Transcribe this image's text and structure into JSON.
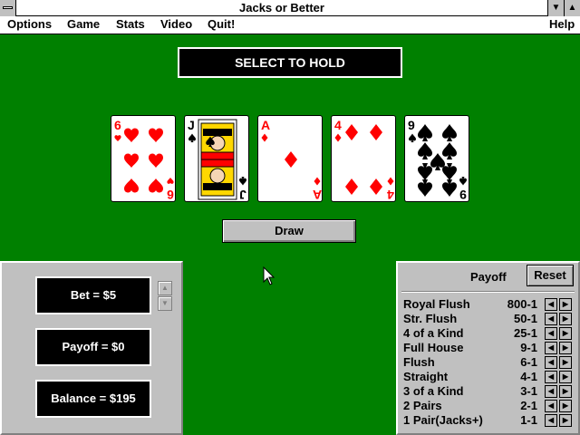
{
  "window": {
    "title": "Jacks or Better"
  },
  "menu": {
    "options": "Options",
    "game": "Game",
    "stats": "Stats",
    "video": "Video",
    "quit": "Quit!",
    "help": "Help"
  },
  "banner": "SELECT TO HOLD",
  "cards": [
    {
      "rank": "6",
      "suit": "hearts",
      "color": "#ff0000"
    },
    {
      "rank": "J",
      "suit": "spades",
      "color": "#000000"
    },
    {
      "rank": "A",
      "suit": "diamonds",
      "color": "#ff0000"
    },
    {
      "rank": "4",
      "suit": "diamonds",
      "color": "#ff0000"
    },
    {
      "rank": "9",
      "suit": "spades",
      "color": "#000000"
    }
  ],
  "draw_label": "Draw",
  "left": {
    "bet": "Bet = $5",
    "payoff": "Payoff = $0",
    "balance": "Balance = $195"
  },
  "payoff": {
    "title": "Payoff",
    "reset": "Reset",
    "rows": [
      {
        "hand": "Royal Flush",
        "odds": "800-1"
      },
      {
        "hand": "Str. Flush",
        "odds": "50-1"
      },
      {
        "hand": "4 of a Kind",
        "odds": "25-1"
      },
      {
        "hand": "Full House",
        "odds": "9-1"
      },
      {
        "hand": "Flush",
        "odds": "6-1"
      },
      {
        "hand": "Straight",
        "odds": "4-1"
      },
      {
        "hand": "3 of a Kind",
        "odds": "3-1"
      },
      {
        "hand": "2 Pairs",
        "odds": "2-1"
      },
      {
        "hand": "1 Pair(Jacks+)",
        "odds": "1-1"
      }
    ]
  }
}
